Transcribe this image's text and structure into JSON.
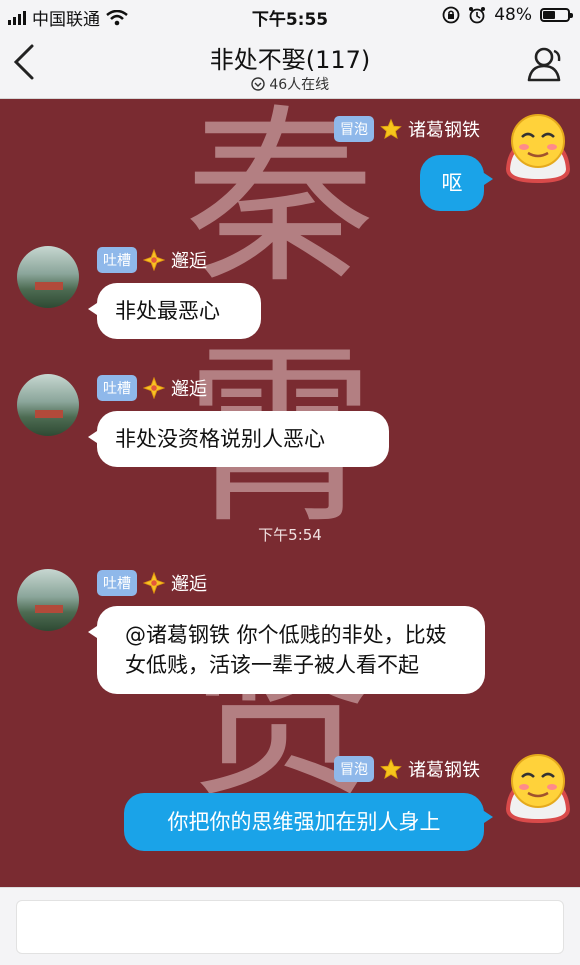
{
  "status_bar": {
    "carrier": "中国联通",
    "time": "下午5:55",
    "battery_percent": "48%",
    "battery_level": 0.48
  },
  "header": {
    "title": "非处不娶(117)",
    "online": "46人在线",
    "back_icon": "chevron-left-icon",
    "profile_icon": "group-members-icon"
  },
  "chat": {
    "background_color": "#7a2b31",
    "watermark": [
      "秦",
      "霄",
      "贤"
    ],
    "messages": [
      {
        "side": "right",
        "tag": "冒泡",
        "badge": "star-icon",
        "name": "诸葛钢铁",
        "text": "呕"
      },
      {
        "side": "left",
        "tag": "吐槽",
        "badge": "diamond-icon",
        "name": "邂逅",
        "text": "非处最恶心"
      },
      {
        "side": "left",
        "tag": "吐槽",
        "badge": "diamond-icon",
        "name": "邂逅",
        "text": "非处没资格说别人恶心"
      },
      {
        "side": "left",
        "tag": "吐槽",
        "badge": "diamond-icon",
        "name": "邂逅",
        "text": "@诸葛钢铁 你个低贱的非处，比妓女低贱，活该一辈子被人看不起"
      },
      {
        "side": "right",
        "tag": "冒泡",
        "badge": "star-icon",
        "name": "诸葛钢铁",
        "text": "你把你的思维强加在别人身上"
      }
    ],
    "timestamp": "下午5:54"
  },
  "input": {
    "placeholder": ""
  }
}
